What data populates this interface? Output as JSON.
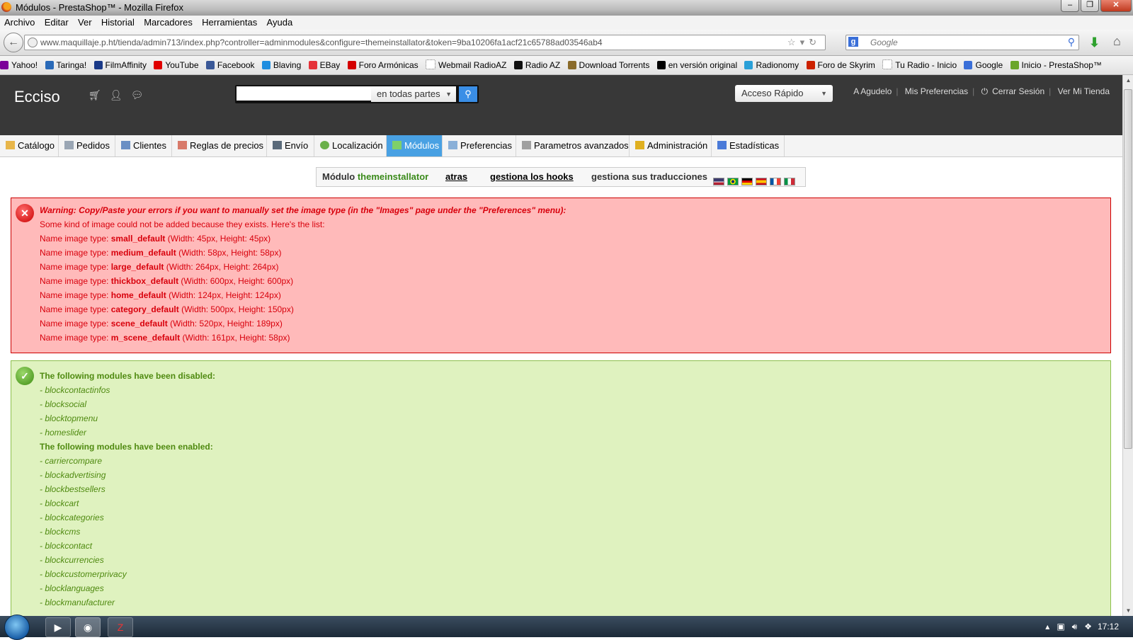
{
  "window": {
    "title": "Módulos - PrestaShop™ - Mozilla Firefox",
    "buttons": [
      "minimize",
      "maximize",
      "close"
    ]
  },
  "menu": [
    "Archivo",
    "Editar",
    "Ver",
    "Historial",
    "Marcadores",
    "Herramientas",
    "Ayuda"
  ],
  "url": "www.maquillaje.p.ht/tienda/admin713/index.php?controller=adminmodules&configure=themeinstallator&token=9ba10206fa1acf21c65788ad03546ab4",
  "browser_search": {
    "placeholder": "Google"
  },
  "bookmarks": [
    {
      "label": "Yahoo!",
      "color": "#7b0099"
    },
    {
      "label": "Taringa!",
      "color": "#2a6ab8"
    },
    {
      "label": "FilmAffinity",
      "color": "#1a3a88"
    },
    {
      "label": "YouTube",
      "color": "#e00000"
    },
    {
      "label": "Facebook",
      "color": "#3b5998"
    },
    {
      "label": "Blaving",
      "color": "#1f8ee0"
    },
    {
      "label": "EBay",
      "color": "#e53238"
    },
    {
      "label": "Foro Armónicas",
      "color": "#d40000"
    },
    {
      "label": "Webmail RadioAZ",
      "color": "#ffffff"
    },
    {
      "label": "Radio AZ",
      "color": "#111111"
    },
    {
      "label": "Download Torrents",
      "color": "#8a6b2a"
    },
    {
      "label": "en versión original",
      "color": "#000000"
    },
    {
      "label": "Radionomy",
      "color": "#2aa0d8"
    },
    {
      "label": "Foro de Skyrim",
      "color": "#cc2200"
    },
    {
      "label": "Tu Radio - Inicio",
      "color": "#ffffff"
    },
    {
      "label": "Google",
      "color": "#3a6fd8"
    },
    {
      "label": "Inicio - PrestaShop™",
      "color": "#6aa62a"
    }
  ],
  "shop": {
    "name": "Ecciso",
    "search_scope": "en todas partes",
    "quick_access": "Acceso Rápido",
    "links": [
      "A Agudelo",
      "Mis Preferencias",
      "Cerrar Sesión",
      "Ver Mi Tienda"
    ]
  },
  "tabs": [
    {
      "label": "Catálogo",
      "active": false
    },
    {
      "label": "Pedidos",
      "active": false
    },
    {
      "label": "Clientes",
      "active": false
    },
    {
      "label": "Reglas de precios",
      "active": false
    },
    {
      "label": "Envío",
      "active": false
    },
    {
      "label": "Localización",
      "active": false
    },
    {
      "label": "Módulos",
      "active": true
    },
    {
      "label": "Preferencias",
      "active": false
    },
    {
      "label": "Parametros avanzados",
      "active": false
    },
    {
      "label": "Administración",
      "active": false
    },
    {
      "label": "Estadísticas",
      "active": false
    }
  ],
  "module_bar": {
    "prefix": "Módulo ",
    "module_name": "themeinstallator",
    "back": "atras",
    "hooks": "gestiona los hooks",
    "translations": "gestiona sus traducciones",
    "flags": [
      "en",
      "pt-br",
      "de",
      "es",
      "fr",
      "it"
    ]
  },
  "error_box": {
    "warning": "Warning: Copy/Paste your errors if you want to manually set the image type (in the \"Images\" page under the \"Preferences\" menu):",
    "intro": "Some kind of image could not be added because they exists. Here's the list:",
    "prefix": "Name image type: ",
    "items": [
      {
        "name": "small_default",
        "dims": " (Width: 45px, Height: 45px)"
      },
      {
        "name": "medium_default",
        "dims": " (Width: 58px, Height: 58px)"
      },
      {
        "name": "large_default",
        "dims": " (Width: 264px, Height: 264px)"
      },
      {
        "name": "thickbox_default",
        "dims": " (Width: 600px, Height: 600px)"
      },
      {
        "name": "home_default",
        "dims": " (Width: 124px, Height: 124px)"
      },
      {
        "name": "category_default",
        "dims": " (Width: 500px, Height: 150px)"
      },
      {
        "name": "scene_default",
        "dims": " (Width: 520px, Height: 189px)"
      },
      {
        "name": "m_scene_default",
        "dims": " (Width: 161px, Height: 58px)"
      }
    ]
  },
  "success_box": {
    "disabled_title": "The following modules have been disabled:",
    "disabled": [
      "- blockcontactinfos",
      "- blocksocial",
      "- blocktopmenu",
      "- homeslider"
    ],
    "enabled_title": "The following modules have been enabled:",
    "enabled": [
      "- carriercompare",
      "- blockadvertising",
      "- blockbestsellers",
      "- blockcart",
      "- blockcategories",
      "- blockcms",
      "- blockcontact",
      "- blockcurrencies",
      "- blockcustomerprivacy",
      "- blocklanguages",
      "- blockmanufacturer"
    ]
  },
  "taskbar": {
    "time": "17:12"
  }
}
